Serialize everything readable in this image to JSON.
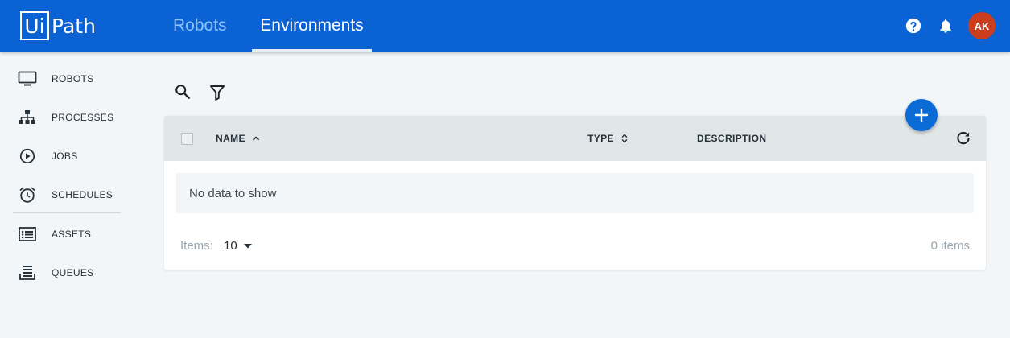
{
  "header": {
    "logo_box": "Ui",
    "logo_text": "Path",
    "tabs": [
      {
        "label": "Robots",
        "active": false
      },
      {
        "label": "Environments",
        "active": true
      }
    ],
    "avatar_initials": "AK",
    "icons": [
      "help-icon",
      "bell-icon"
    ]
  },
  "sidebar": {
    "items": [
      {
        "label": "ROBOTS",
        "icon": "monitor-icon"
      },
      {
        "label": "PROCESSES",
        "icon": "hierarchy-icon"
      },
      {
        "label": "JOBS",
        "icon": "play-circle-icon"
      },
      {
        "label": "SCHEDULES",
        "icon": "alarm-clock-icon"
      },
      {
        "label": "ASSETS",
        "icon": "list-box-icon"
      },
      {
        "label": "QUEUES",
        "icon": "queue-stack-icon"
      }
    ]
  },
  "toolbar": {
    "icons": [
      "search-icon",
      "filter-icon",
      "add-icon"
    ]
  },
  "table": {
    "columns": [
      {
        "label": "NAME",
        "sort": "ascending"
      },
      {
        "label": "TYPE",
        "sort": "sortable"
      },
      {
        "label": "DESCRIPTION",
        "sort": "none"
      }
    ],
    "empty_message": "No data to show",
    "page_size_label": "Items:",
    "page_size_value": "10",
    "total_items": "0 items"
  },
  "colors": {
    "header_bg": "#0a62d4",
    "active_tab": "#ffffff",
    "inactive_tab": "#8ec3f7",
    "fab": "#0a6ad6",
    "avatar": "#cc3d1d"
  }
}
